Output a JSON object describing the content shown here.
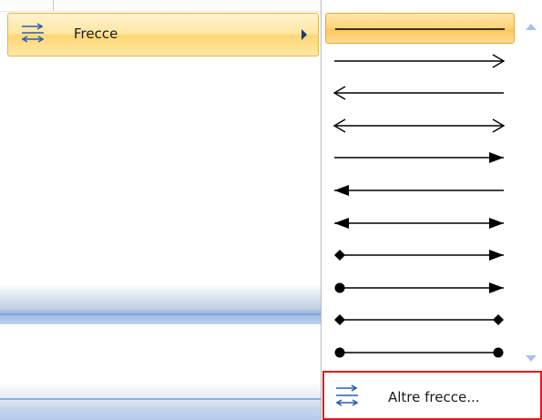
{
  "parent_menu": {
    "item": {
      "label": "Frecce",
      "icon": "arrows-icon"
    }
  },
  "submenu": {
    "arrow_styles": [
      {
        "id": "line-plain",
        "start": "none",
        "end": "none",
        "selected": true
      },
      {
        "id": "open-end",
        "start": "none",
        "end": "open"
      },
      {
        "id": "open-start",
        "start": "open",
        "end": "none"
      },
      {
        "id": "open-both",
        "start": "open",
        "end": "open"
      },
      {
        "id": "filled-end",
        "start": "none",
        "end": "triangle"
      },
      {
        "id": "filled-start",
        "start": "triangle",
        "end": "none"
      },
      {
        "id": "filled-both",
        "start": "triangle",
        "end": "triangle"
      },
      {
        "id": "diamond-triangle",
        "start": "diamond",
        "end": "triangle"
      },
      {
        "id": "circle-triangle",
        "start": "circle",
        "end": "triangle"
      },
      {
        "id": "diamond-diamond",
        "start": "diamond",
        "end": "diamond"
      },
      {
        "id": "circle-circle",
        "start": "circle",
        "end": "circle"
      }
    ],
    "more_label": "Altre frecce...",
    "highlight_color": "#e01d1d"
  }
}
